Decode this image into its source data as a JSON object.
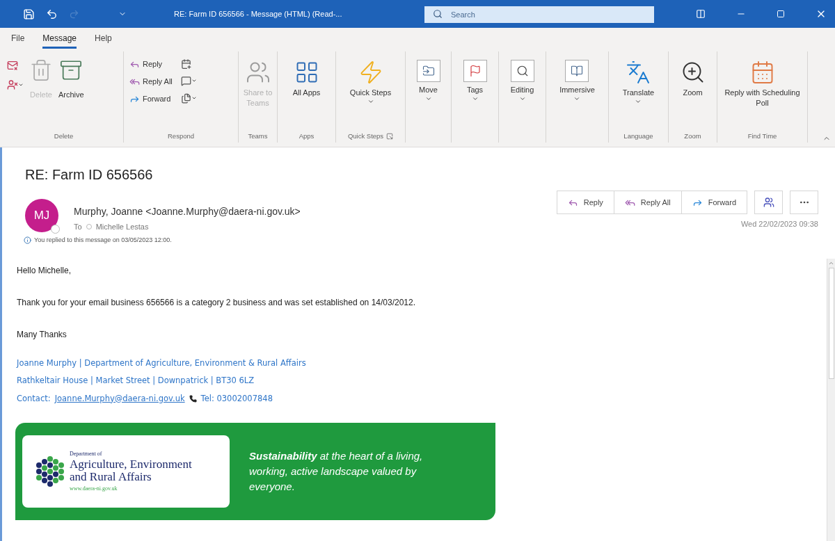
{
  "title_bar": {
    "title": "RE: Farm ID 656566  -  Message (HTML) (Read-...",
    "search": {
      "placeholder": "Search"
    }
  },
  "ribbon_tabs": [
    {
      "label": "File",
      "selected": false
    },
    {
      "label": "Message",
      "selected": true
    },
    {
      "label": "Help",
      "selected": false
    }
  ],
  "ribbon_groups": [
    {
      "kind": "delete",
      "label": "Delete",
      "buttons": [
        {
          "label": "Delete",
          "disabled": true,
          "dropdown": false
        },
        {
          "label": "Archive",
          "disabled": false,
          "dropdown": false
        }
      ]
    },
    {
      "kind": "respond",
      "label": "Respond",
      "buttons": [
        {
          "label": "Reply",
          "disabled": false
        },
        {
          "label": "Reply All",
          "disabled": false
        },
        {
          "label": "Forward",
          "disabled": false
        }
      ]
    },
    {
      "kind": "teams",
      "label": "Teams",
      "buttons": [
        {
          "label": "Share to Teams",
          "disabled": true,
          "dropdown": false
        }
      ]
    },
    {
      "kind": "apps",
      "label": "Apps",
      "buttons": [
        {
          "label": "All Apps",
          "disabled": false,
          "dropdown": false
        }
      ]
    },
    {
      "kind": "quicksteps",
      "label": "Quick Steps",
      "buttons": [
        {
          "label": "Quick Steps",
          "disabled": false,
          "dropdown": true
        }
      ]
    },
    {
      "kind": "move",
      "buttons": [
        {
          "label": "Move",
          "disabled": false,
          "dropdown": true
        }
      ]
    },
    {
      "kind": "tags",
      "buttons": [
        {
          "label": "Tags",
          "disabled": false,
          "dropdown": true
        }
      ]
    },
    {
      "kind": "editing",
      "buttons": [
        {
          "label": "Editing",
          "disabled": false,
          "dropdown": true
        }
      ]
    },
    {
      "kind": "immersive",
      "buttons": [
        {
          "label": "Immersive",
          "disabled": false,
          "dropdown": true
        }
      ]
    },
    {
      "kind": "translate",
      "label": "Language",
      "buttons": [
        {
          "label": "Translate",
          "disabled": false,
          "dropdown": true
        }
      ]
    },
    {
      "kind": "zoom",
      "label": "Zoom",
      "buttons": [
        {
          "label": "Zoom",
          "disabled": false,
          "dropdown": false
        }
      ]
    },
    {
      "kind": "poll",
      "label": "Find Time",
      "buttons": [
        {
          "label": "Reply with Scheduling Poll",
          "disabled": false,
          "dropdown": false
        }
      ]
    }
  ],
  "message": {
    "subject": "RE: Farm ID 656566",
    "sender": {
      "initials": "MJ",
      "name": "Murphy, Joanne <Joanne.Murphy@daera-ni.gov.uk>",
      "to_label": "To",
      "recipient": "Michelle Lestas"
    },
    "actions": [
      {
        "kind": "reply",
        "label": "Reply"
      },
      {
        "kind": "replyall",
        "label": "Reply All"
      },
      {
        "kind": "forward",
        "label": "Forward"
      }
    ],
    "date": "Wed 22/02/2023 09:38",
    "info": "You replied to this message on 03/05/2023 12:00.",
    "body": [
      "Hello Michelle,",
      "Thank you for your email business 656566 is a category 2 business and was set established on 14/03/2012.",
      "Many Thanks"
    ],
    "signature": {
      "line_1": "Joanne Murphy | Department of Agriculture, Environment & Rural Affairs",
      "line_2": "Rathkeltair House | Market Street | Downpatrick | BT30 6LZ",
      "contact_label": "Contact:",
      "email": "Joanne.Murphy@daera-ni.gov.uk",
      "phone": "Tel: 03002007848"
    },
    "banner": {
      "dept_small": "Department of",
      "dept_line_1": "Agriculture, Environment",
      "dept_line_2": "and Rural Affairs",
      "url": "www.daera-ni.gov.uk",
      "slogan": "**Sustainability** at the heart of a living, working, active landscape valued by everyone."
    }
  }
}
